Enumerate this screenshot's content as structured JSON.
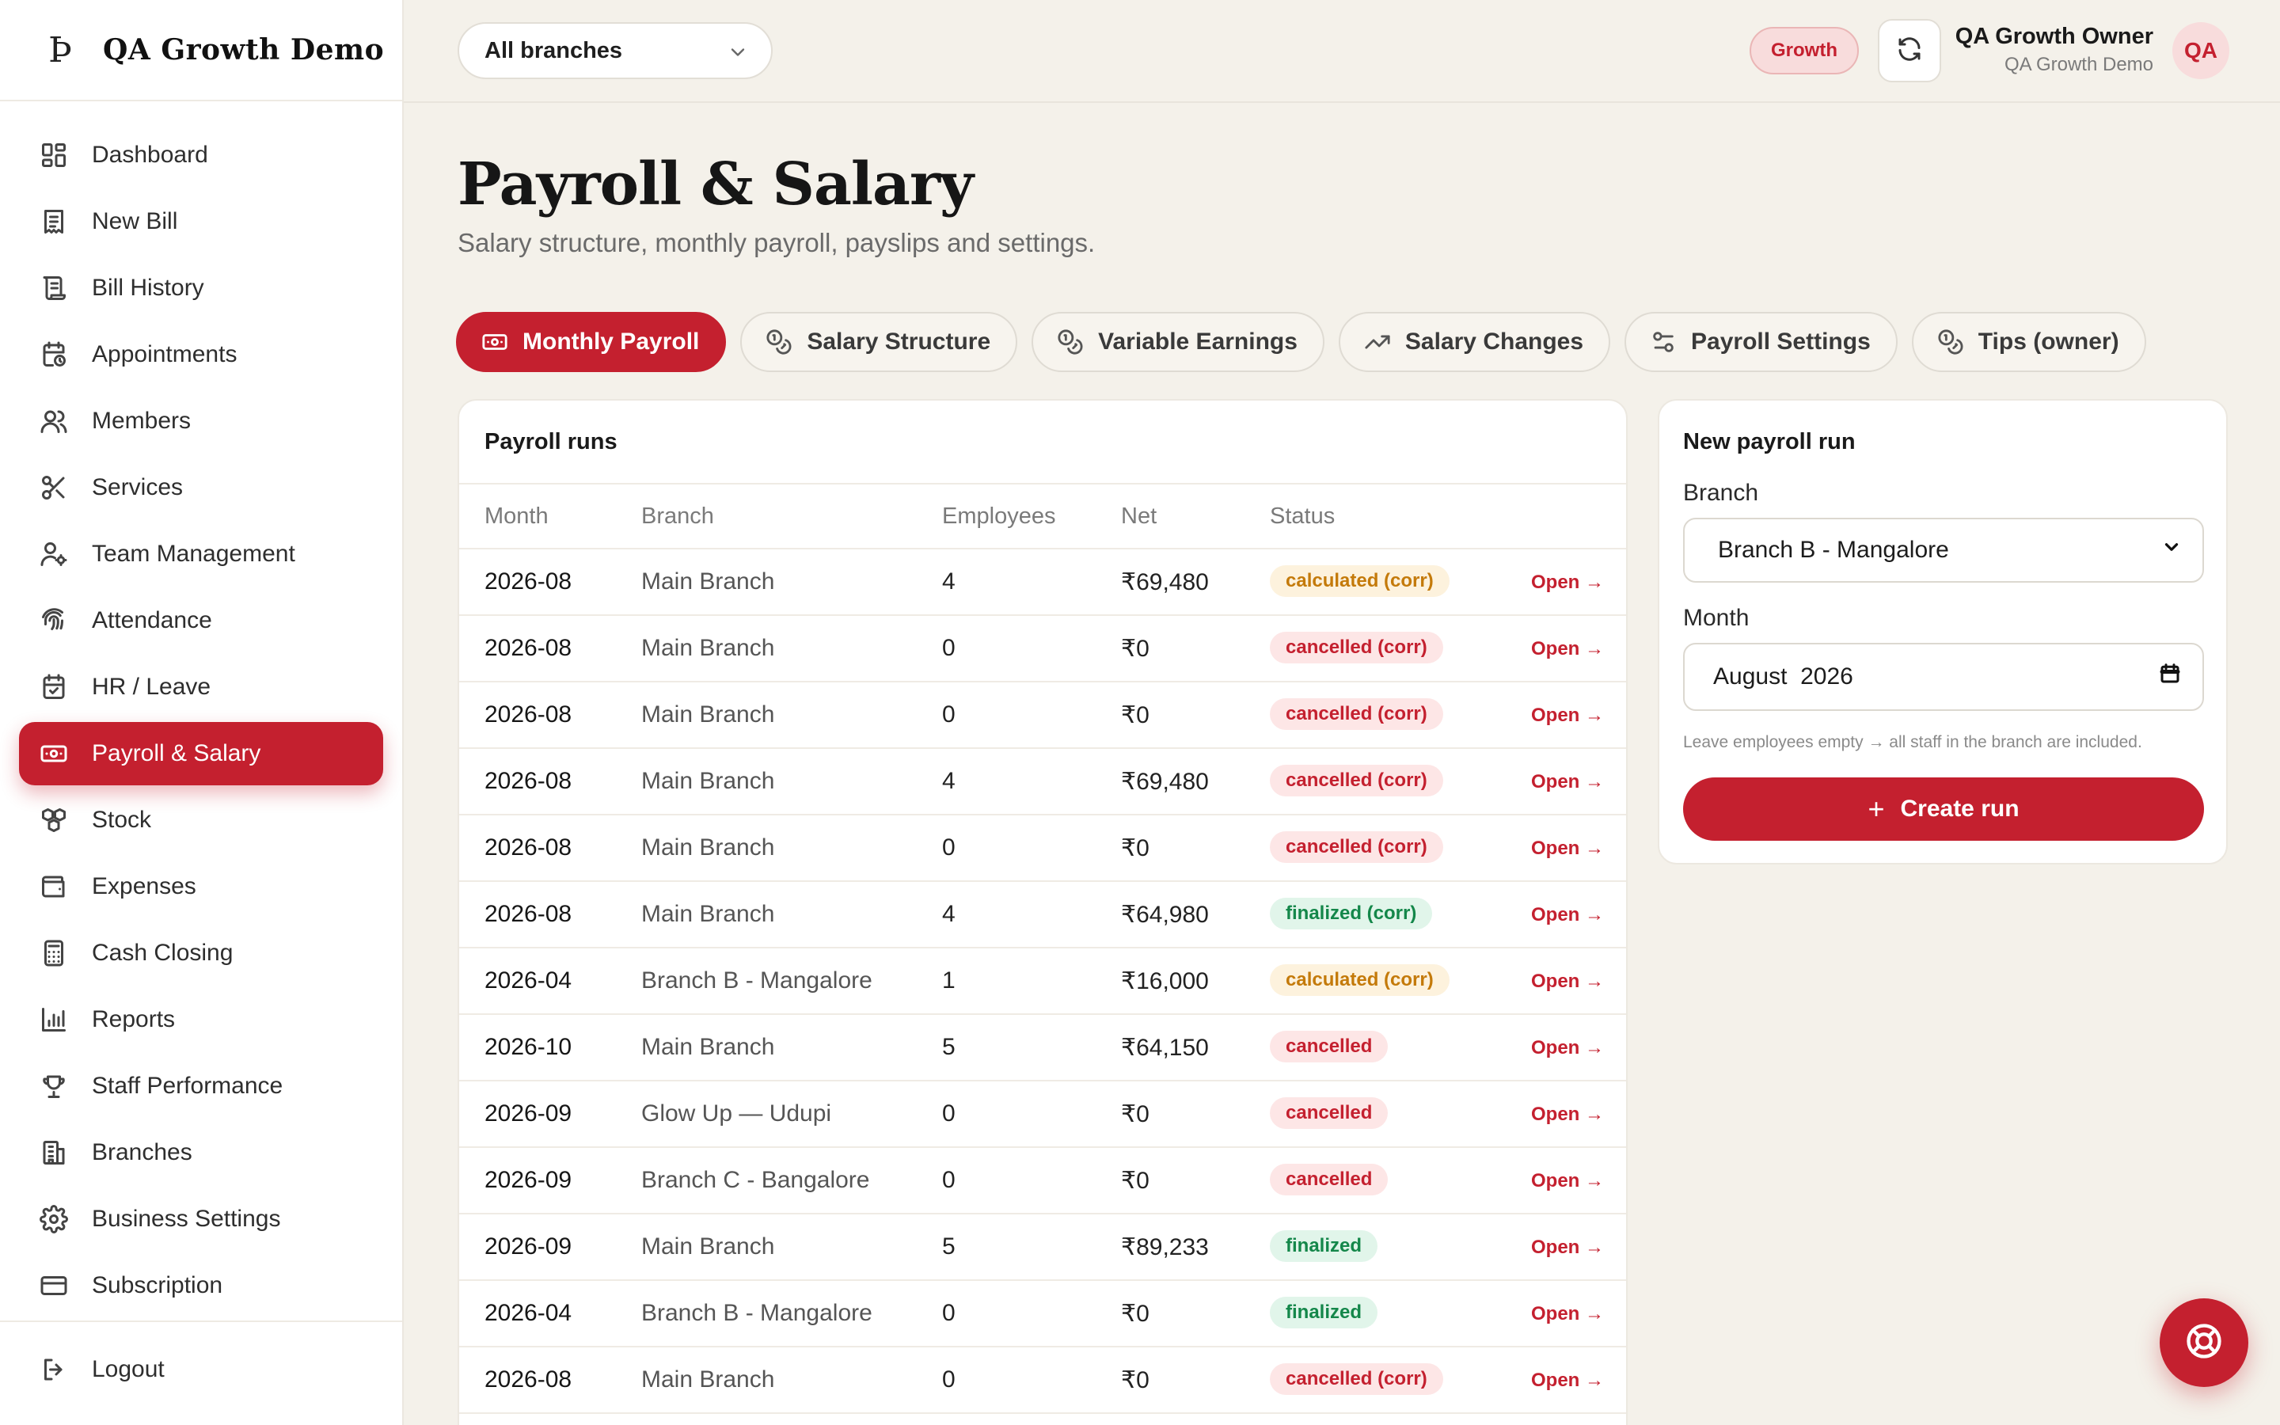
{
  "brand": {
    "mark": "Þ",
    "name": "QA Growth Demo"
  },
  "sidebar": {
    "items": [
      {
        "label": "Dashboard",
        "icon": "dashboard-icon"
      },
      {
        "label": "New Bill",
        "icon": "receipt-icon"
      },
      {
        "label": "Bill History",
        "icon": "scroll-icon"
      },
      {
        "label": "Appointments",
        "icon": "calendar-clock-icon"
      },
      {
        "label": "Members",
        "icon": "users-icon"
      },
      {
        "label": "Services",
        "icon": "scissors-icon"
      },
      {
        "label": "Team Management",
        "icon": "user-cog-icon"
      },
      {
        "label": "Attendance",
        "icon": "fingerprint-icon"
      },
      {
        "label": "HR / Leave",
        "icon": "calendar-check-icon"
      },
      {
        "label": "Payroll & Salary",
        "icon": "banknote-icon",
        "active": true
      },
      {
        "label": "Stock",
        "icon": "boxes-icon"
      },
      {
        "label": "Expenses",
        "icon": "wallet-icon"
      },
      {
        "label": "Cash Closing",
        "icon": "calculator-icon"
      },
      {
        "label": "Reports",
        "icon": "bar-chart-icon"
      },
      {
        "label": "Staff Performance",
        "icon": "trophy-icon"
      },
      {
        "label": "Branches",
        "icon": "building-icon"
      },
      {
        "label": "Business Settings",
        "icon": "gear-icon"
      },
      {
        "label": "Subscription",
        "icon": "credit-card-icon"
      }
    ],
    "logout": "Logout"
  },
  "topbar": {
    "branch_filter": "All branches",
    "plan_badge": "Growth",
    "user_name": "QA Growth Owner",
    "user_org": "QA Growth Demo",
    "avatar": "QA"
  },
  "page": {
    "title": "Payroll & Salary",
    "subtitle": "Salary structure, monthly payroll, payslips and settings."
  },
  "tabs": [
    {
      "label": "Monthly Payroll",
      "icon": "banknote-icon",
      "active": true
    },
    {
      "label": "Salary Structure",
      "icon": "coins-icon"
    },
    {
      "label": "Variable Earnings",
      "icon": "coins-icon"
    },
    {
      "label": "Salary Changes",
      "icon": "trending-up-icon"
    },
    {
      "label": "Payroll Settings",
      "icon": "sliders-icon"
    },
    {
      "label": "Tips (owner)",
      "icon": "coins-icon"
    }
  ],
  "runs": {
    "title": "Payroll runs",
    "columns": {
      "month": "Month",
      "branch": "Branch",
      "employees": "Employees",
      "net": "Net",
      "status": "Status"
    },
    "open_label": "Open →",
    "rows": [
      {
        "month": "2026-08",
        "branch": "Main Branch",
        "employees": "4",
        "net": "₹69,480",
        "status": "calculated (corr)",
        "kind": "calc"
      },
      {
        "month": "2026-08",
        "branch": "Main Branch",
        "employees": "0",
        "net": "₹0",
        "status": "cancelled (corr)",
        "kind": "canc"
      },
      {
        "month": "2026-08",
        "branch": "Main Branch",
        "employees": "0",
        "net": "₹0",
        "status": "cancelled (corr)",
        "kind": "canc"
      },
      {
        "month": "2026-08",
        "branch": "Main Branch",
        "employees": "4",
        "net": "₹69,480",
        "status": "cancelled (corr)",
        "kind": "canc"
      },
      {
        "month": "2026-08",
        "branch": "Main Branch",
        "employees": "0",
        "net": "₹0",
        "status": "cancelled (corr)",
        "kind": "canc"
      },
      {
        "month": "2026-08",
        "branch": "Main Branch",
        "employees": "4",
        "net": "₹64,980",
        "status": "finalized (corr)",
        "kind": "fin"
      },
      {
        "month": "2026-04",
        "branch": "Branch B - Mangalore",
        "employees": "1",
        "net": "₹16,000",
        "status": "calculated (corr)",
        "kind": "calc"
      },
      {
        "month": "2026-10",
        "branch": "Main Branch",
        "employees": "5",
        "net": "₹64,150",
        "status": "cancelled",
        "kind": "canc"
      },
      {
        "month": "2026-09",
        "branch": "Glow Up — Udupi",
        "employees": "0",
        "net": "₹0",
        "status": "cancelled",
        "kind": "canc"
      },
      {
        "month": "2026-09",
        "branch": "Branch C - Bangalore",
        "employees": "0",
        "net": "₹0",
        "status": "cancelled",
        "kind": "canc"
      },
      {
        "month": "2026-09",
        "branch": "Main Branch",
        "employees": "5",
        "net": "₹89,233",
        "status": "finalized",
        "kind": "fin"
      },
      {
        "month": "2026-04",
        "branch": "Branch B - Mangalore",
        "employees": "0",
        "net": "₹0",
        "status": "finalized",
        "kind": "fin"
      },
      {
        "month": "2026-08",
        "branch": "Main Branch",
        "employees": "0",
        "net": "₹0",
        "status": "cancelled (corr)",
        "kind": "canc"
      }
    ]
  },
  "new_run": {
    "title": "New payroll run",
    "branch_label": "Branch",
    "branch_value": "Branch B - Mangalore",
    "month_label": "Month",
    "month_value": "August  2026",
    "hint": "Leave employees empty → all staff in the branch are included.",
    "create_label": "Create run"
  },
  "colors": {
    "accent": "#c4202f",
    "background": "#f4f1ea",
    "success": "#14874a",
    "warning": "#c47a0a"
  }
}
